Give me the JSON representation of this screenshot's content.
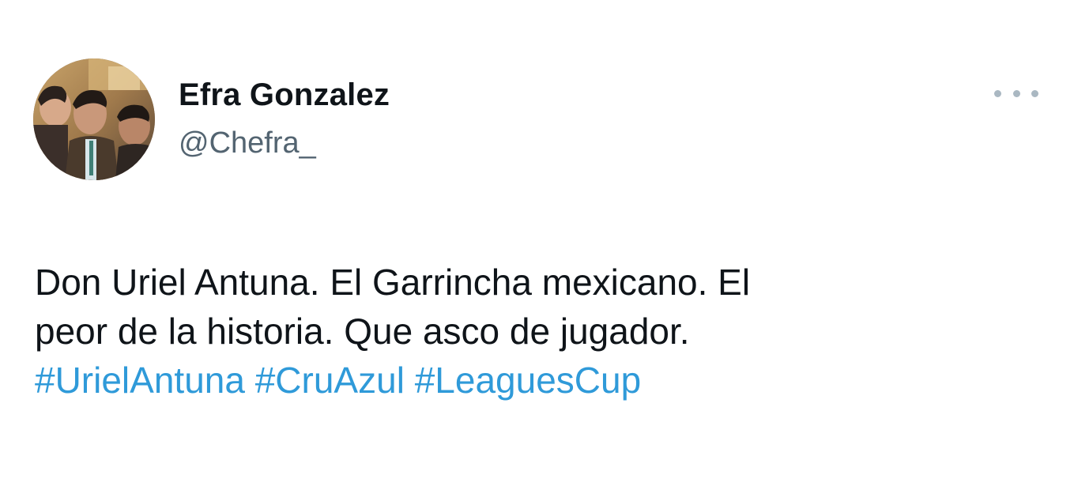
{
  "tweet": {
    "author": {
      "display_name": "Efra Gonzalez",
      "handle": "@Chefra_",
      "avatar_icon": "profile-photo"
    },
    "more_icon": "ellipsis-icon",
    "text_lines": [
      "Don Uriel Antuna. El Garrincha mexicano. El",
      "peor de la historia. Que asco de jugador."
    ],
    "hashtags": [
      "#UrielAntuna",
      "#CruAzul",
      "#LeaguesCup"
    ]
  },
  "colors": {
    "text": "#0f1419",
    "handle": "#536471",
    "hashtag": "#2f9ad9",
    "more_dots": "#aab8c2"
  }
}
